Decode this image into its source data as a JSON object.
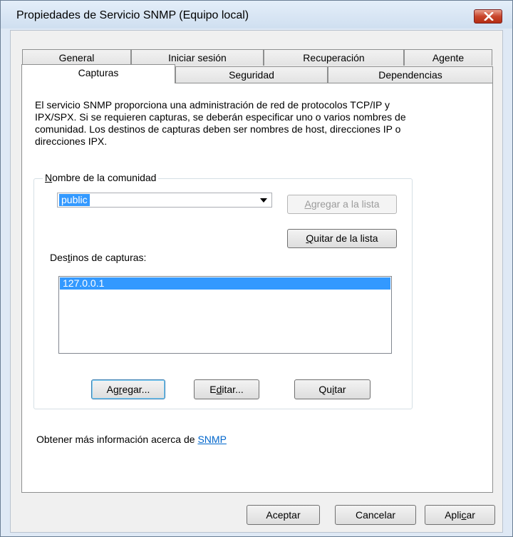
{
  "window": {
    "title": "Propiedades de Servicio SNMP (Equipo local)"
  },
  "tabs": {
    "row1": [
      "General",
      "Iniciar sesión",
      "Recuperación",
      "Agente"
    ],
    "row2": [
      "Capturas",
      "Seguridad",
      "Dependencias"
    ],
    "active": "Capturas"
  },
  "description": "El servicio SNMP proporciona una administración de red de protocolos TCP/IP y IPX/SPX. Si se requieren capturas, se deberán especificar uno o varios nombres de comunidad. Los destinos de capturas deben ser nombres de host, direcciones IP o direcciones IPX.",
  "community": {
    "legend_pre": "",
    "legend_key": "N",
    "legend_post": "ombre de la comunidad",
    "value": "public",
    "add_pre": "",
    "add_key": "A",
    "add_post": "gregar a la lista",
    "remove_pre": "",
    "remove_key": "Q",
    "remove_post": "uitar de la lista"
  },
  "destinations": {
    "label_pre": "Des",
    "label_key": "t",
    "label_post": "inos de capturas:",
    "items": [
      "127.0.0.1"
    ],
    "add_pre": "Ag",
    "add_key": "r",
    "add_post": "egar...",
    "edit_pre": "E",
    "edit_key": "d",
    "edit_post": "itar...",
    "remove_pre": "Qu",
    "remove_key": "i",
    "remove_post": "tar"
  },
  "footer": {
    "more_info": "Obtener más información acerca de",
    "link": "SNMP"
  },
  "buttons": {
    "ok": "Aceptar",
    "cancel": "Cancelar",
    "apply_pre": "Apli",
    "apply_key": "c",
    "apply_post": "ar"
  }
}
